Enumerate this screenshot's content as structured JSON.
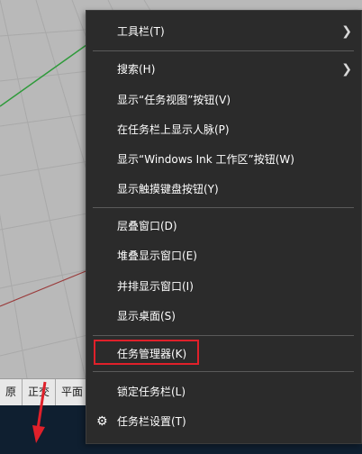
{
  "background": {
    "status_cells": [
      "原",
      "正交",
      "平面"
    ]
  },
  "context_menu": {
    "toolbars": "工具栏(T)",
    "search": "搜索(H)",
    "show_task_view": "显示“任务视图”按钮(V)",
    "show_people": "在任务栏上显示人脉(P)",
    "show_ink": "显示“Windows Ink 工作区”按钮(W)",
    "show_touch_keyboard": "显示触摸键盘按钮(Y)",
    "cascade": "层叠窗口(D)",
    "stacked": "堆叠显示窗口(E)",
    "side_by_side": "并排显示窗口(I)",
    "show_desktop": "显示桌面(S)",
    "task_manager": "任务管理器(K)",
    "lock_taskbar": "锁定任务栏(L)",
    "taskbar_settings": "任务栏设置(T)"
  },
  "icons": {
    "submenu": "chevron-right-icon",
    "settings": "gear-icon",
    "annotation": "red-arrow"
  },
  "colors": {
    "menu_bg": "#2b2b2b",
    "menu_text": "#ffffff",
    "highlight": "#e0202a",
    "taskbar": "#0f1f30"
  }
}
